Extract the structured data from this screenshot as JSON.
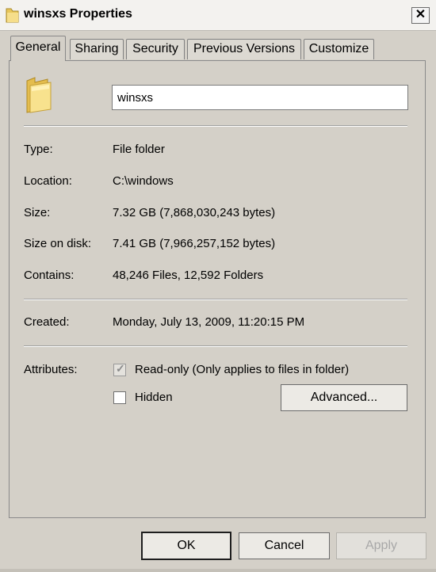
{
  "window": {
    "title": "winsxs Properties",
    "close_glyph": "✕"
  },
  "tabs": [
    {
      "label": "General",
      "active": true
    },
    {
      "label": "Sharing",
      "active": false
    },
    {
      "label": "Security",
      "active": false
    },
    {
      "label": "Previous Versions",
      "active": false
    },
    {
      "label": "Customize",
      "active": false
    }
  ],
  "general": {
    "folder_name": "winsxs",
    "type_label": "Type:",
    "type_value": "File folder",
    "location_label": "Location:",
    "location_value": "C:\\windows",
    "size_label": "Size:",
    "size_value": "7.32 GB (7,868,030,243 bytes)",
    "size_on_disk_label": "Size on disk:",
    "size_on_disk_value": "7.41 GB (7,966,257,152 bytes)",
    "contains_label": "Contains:",
    "contains_value": "48,246 Files, 12,592 Folders",
    "created_label": "Created:",
    "created_value": "Monday, July 13, 2009, 11:20:15 PM",
    "attributes_label": "Attributes:",
    "readonly_label": "Read-only (Only applies to files in folder)",
    "readonly_checked": true,
    "hidden_label": "Hidden",
    "hidden_checked": false,
    "advanced_label": "Advanced..."
  },
  "buttons": {
    "ok": "OK",
    "cancel": "Cancel",
    "apply": "Apply"
  },
  "colors": {
    "dialog_bg": "#d4d0c8",
    "folder_yellow": "#f2d67a"
  },
  "icons": {
    "title": "folder-icon",
    "large": "folder-icon"
  }
}
